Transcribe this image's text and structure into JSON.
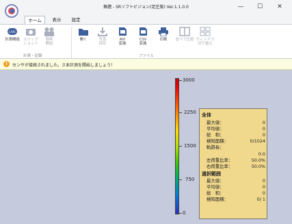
{
  "window": {
    "title": "無題 - SRソフトビジョン(足圧版) Ver.1.1.0.0",
    "minimize": "—",
    "maximize": "☐",
    "close": "✕"
  },
  "tabs": [
    "ホーム",
    "表示",
    "設定"
  ],
  "ribbon": {
    "groups": [
      "計測・記録",
      "ファイル"
    ],
    "buttons": [
      {
        "icon": "live-icon",
        "line1": "計測開始",
        "line2": ""
      },
      {
        "icon": "camera-icon",
        "line1": "スナップ",
        "line2": "ショット"
      },
      {
        "icon": "record-icon",
        "line1": "録画",
        "line2": "開始"
      },
      {
        "icon": "open-folder-icon",
        "line1": "開く",
        "line2": ""
      },
      {
        "icon": "save-photo-icon",
        "line1": "写真",
        "line2": "保存"
      },
      {
        "icon": "avi-convert-icon",
        "line1": "AVI",
        "line2": "変換"
      },
      {
        "icon": "csv-convert-icon",
        "line1": "CSV",
        "line2": "変換"
      },
      {
        "icon": "print-icon",
        "line1": "印刷",
        "line2": ""
      },
      {
        "icon": "compare-icon",
        "line1": "並べて比較",
        "line2": ""
      },
      {
        "icon": "window-switch-icon",
        "line1": "ウィンドウ",
        "line2": "切り替え"
      }
    ]
  },
  "notice": {
    "icon": "info-icon",
    "glyph": "!",
    "text": "センサが接続されました。さあ計測を開始しましょう！"
  },
  "scale": {
    "ticks": [
      "3000",
      "2250",
      "1500",
      "750",
      "0"
    ]
  },
  "stats": {
    "overall_title": "全体",
    "overall": [
      {
        "label": "最大値：",
        "value": "0"
      },
      {
        "label": "平均値：",
        "value": "0"
      },
      {
        "label": "総　和：",
        "value": "0"
      },
      {
        "label": "検知面積：",
        "value": "0/1024"
      },
      {
        "label": "軌跡長：",
        "value": ""
      },
      {
        "label": "",
        "value": "0.0"
      },
      {
        "label": "左荷重比率：",
        "value": "50.0%"
      },
      {
        "label": "右荷重比率：",
        "value": "50.0%"
      }
    ],
    "selection_title": "選択範囲",
    "selection": [
      {
        "label": "最大値：",
        "value": "0"
      },
      {
        "label": "平均値：",
        "value": "0"
      },
      {
        "label": "総　和：",
        "value": "0"
      },
      {
        "label": "検知面積：",
        "value": "0/ 1"
      }
    ]
  }
}
